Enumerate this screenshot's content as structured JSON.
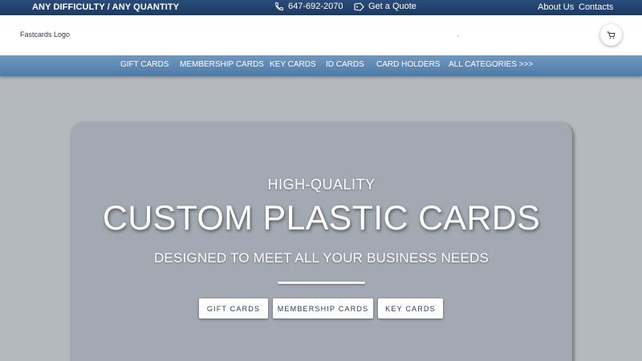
{
  "topbar": {
    "tagline": "ANY DIFFICULTY / ANY QUANTITY",
    "phone": "647-692-2070",
    "quote": "Get a Quote",
    "about": "About Us",
    "contacts": "Contacts"
  },
  "header": {
    "logo_alt": "Fastcards Logo",
    "cart_icon": "cart-icon"
  },
  "nav": {
    "items": [
      "GIFT CARDS",
      "MEMBERSHIP CARDS",
      "KEY CARDS",
      "ID CARDS",
      "CARD HOLDERS",
      "ALL CATEGORIES >>>"
    ]
  },
  "hero": {
    "pretitle": "HIGH-QUALITY",
    "title": "CUSTOM PLASTIC CARDS",
    "subtitle": "DESIGNED TO MEET ALL YOUR BUSINESS NEEDS",
    "buttons": [
      "GIFT CARDS",
      "MEMBERSHIP CARDS",
      "KEY CARDS"
    ]
  },
  "colors": {
    "topbar": "#1c3a63",
    "nav": "#5a86b1",
    "background": "#b4b9be",
    "hero": "#a2a9b2"
  }
}
